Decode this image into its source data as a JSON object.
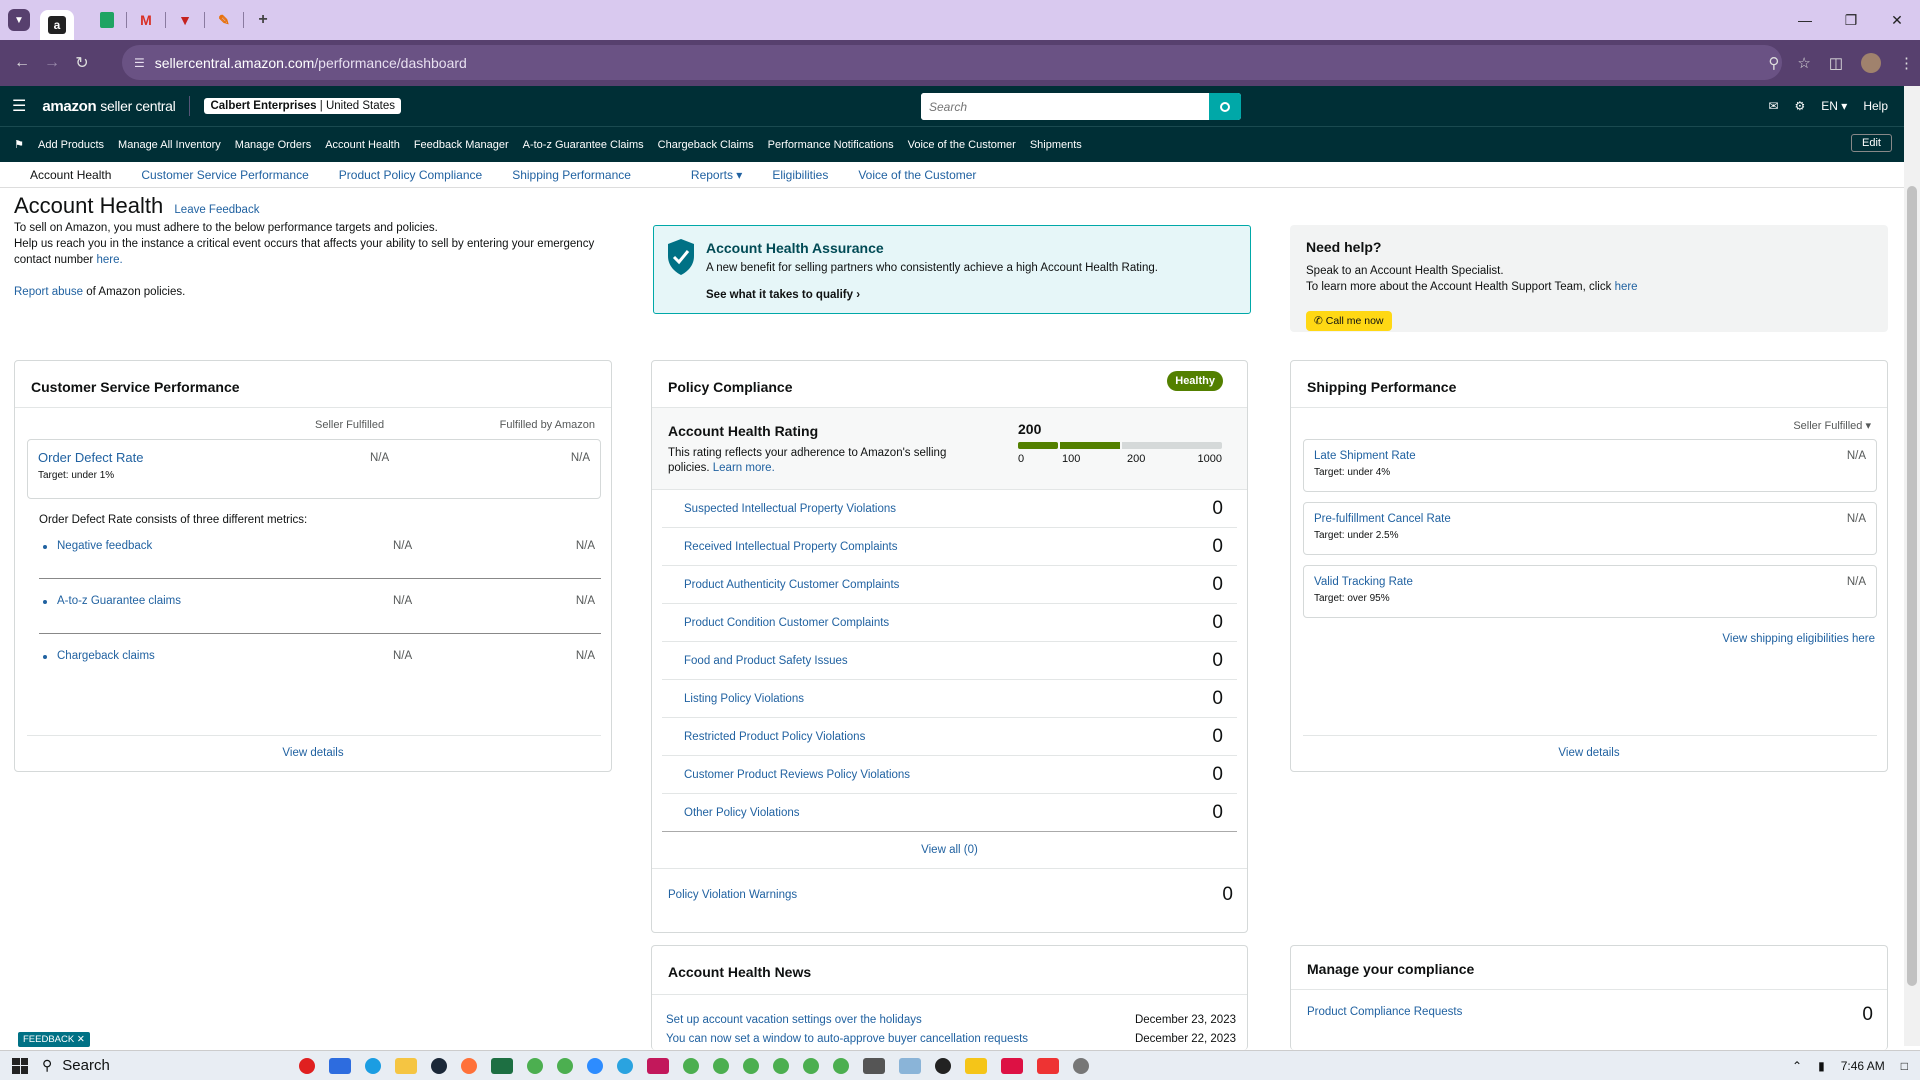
{
  "browser": {
    "url_host": "sellercentral.amazon.com",
    "url_path": "/performance/dashboard"
  },
  "header": {
    "logo_main": "amazon",
    "logo_sub": "seller central",
    "account_name": "Calbert Enterprises",
    "account_region": "United States",
    "search_placeholder": "Search",
    "lang": "EN",
    "help": "Help"
  },
  "nav": {
    "items": [
      "Add Products",
      "Manage All Inventory",
      "Manage Orders",
      "Account Health",
      "Feedback Manager",
      "A-to-z Guarantee Claims",
      "Chargeback Claims",
      "Performance Notifications",
      "Voice of the Customer",
      "Shipments"
    ],
    "edit": "Edit"
  },
  "subnav": {
    "items": [
      "Account Health",
      "Customer Service Performance",
      "Product Policy Compliance",
      "Shipping Performance",
      "Reports",
      "Eligibilities",
      "Voice of the Customer"
    ]
  },
  "intro": {
    "title": "Account Health",
    "leave_feedback": "Leave Feedback",
    "line1": "To sell on Amazon, you must adhere to the below performance targets and policies.",
    "line2": "Help us reach you in the instance a critical event occurs that affects your ability to sell by entering your emergency contact number",
    "here": "here.",
    "report_abuse": "Report abuse",
    "report_rest": "of Amazon policies."
  },
  "assurance": {
    "title": "Account Health Assurance",
    "text": "A new benefit for selling partners who consistently achieve a high Account Health Rating.",
    "link": "See what it takes to qualify"
  },
  "help": {
    "title": "Need help?",
    "line1": "Speak to an Account Health Specialist.",
    "line2": "To learn more about the Account Health Support Team, click",
    "here": "here",
    "button": "Call me now"
  },
  "csp": {
    "title": "Customer Service Performance",
    "col1": "Seller Fulfilled",
    "col2": "Fulfilled by Amazon",
    "odr_label": "Order Defect Rate",
    "odr_target": "Target: under 1%",
    "odr_sf": "N/A",
    "odr_fba": "N/A",
    "consists": "Order Defect Rate consists of three different metrics:",
    "metrics": [
      {
        "label": "Negative feedback",
        "sf": "N/A",
        "fba": "N/A"
      },
      {
        "label": "A-to-z Guarantee claims",
        "sf": "N/A",
        "fba": "N/A"
      },
      {
        "label": "Chargeback claims",
        "sf": "N/A",
        "fba": "N/A"
      }
    ],
    "view_details": "View details"
  },
  "policy": {
    "title": "Policy Compliance",
    "badge": "Healthy",
    "rating_title": "Account Health Rating",
    "rating_text": "This rating reflects your adherence to Amazon's selling policies.",
    "learn_more": "Learn more.",
    "rating_value": "200",
    "rating_fill": 0.2,
    "scale": [
      "0",
      "100",
      "200",
      "1000"
    ],
    "rows": [
      {
        "label": "Suspected Intellectual Property Violations",
        "value": "0"
      },
      {
        "label": "Received Intellectual Property Complaints",
        "value": "0"
      },
      {
        "label": "Product Authenticity Customer Complaints",
        "value": "0"
      },
      {
        "label": "Product Condition Customer Complaints",
        "value": "0"
      },
      {
        "label": "Food and Product Safety Issues",
        "value": "0"
      },
      {
        "label": "Listing Policy Violations",
        "value": "0"
      },
      {
        "label": "Restricted Product Policy Violations",
        "value": "0"
      },
      {
        "label": "Customer Product Reviews Policy Violations",
        "value": "0"
      },
      {
        "label": "Other Policy Violations",
        "value": "0"
      }
    ],
    "view_all": "View all (0)",
    "warnings_label": "Policy Violation Warnings",
    "warnings_value": "0"
  },
  "shipping": {
    "title": "Shipping Performance",
    "dropdown": "Seller Fulfilled",
    "metrics": [
      {
        "label": "Late Shipment Rate",
        "target": "Target: under 4%",
        "value": "N/A"
      },
      {
        "label": "Pre-fulfillment Cancel Rate",
        "target": "Target: under 2.5%",
        "value": "N/A"
      },
      {
        "label": "Valid Tracking Rate",
        "target": "Target: over 95%",
        "value": "N/A"
      }
    ],
    "eligibilities_link": "View shipping eligibilities here",
    "view_details": "View details"
  },
  "news": {
    "title": "Account Health News",
    "items": [
      {
        "text": "Set up account vacation settings over the holidays",
        "date": "December 23, 2023"
      },
      {
        "text": "You can now set a window to auto-approve buyer cancellation requests",
        "date": "December 22, 2023"
      }
    ]
  },
  "compliance": {
    "title": "Manage your compliance",
    "row_label": "Product Compliance Requests",
    "row_value": "0"
  },
  "feedback_tab": "FEEDBACK",
  "taskbar": {
    "search": "Search",
    "time": "7:46 AM"
  },
  "colors": {
    "header_bg": "#002f36",
    "browser_purple": "#57406e",
    "healthy_green": "#538000",
    "link": "#2162a1",
    "assurance_bg": "#e6f6f8",
    "call_yellow": "#ffd814"
  }
}
